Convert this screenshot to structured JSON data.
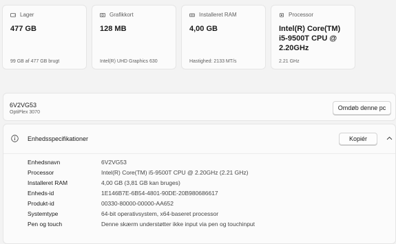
{
  "cards": [
    {
      "label": "Lager",
      "value": "477 GB",
      "sub": "99 GB af 477 GB brugt",
      "icon": "storage-icon"
    },
    {
      "label": "Grafikkort",
      "value": "128 MB",
      "sub": "Intel(R) UHD Graphics 630",
      "icon": "graphics-card-icon"
    },
    {
      "label": "Installeret RAM",
      "value": "4,00 GB",
      "sub": "Hastighed: 2133 MT/s",
      "icon": "memory-icon"
    },
    {
      "label": "Processor",
      "value_lines": [
        "Intel(R) Core(TM)",
        "i5-9500T CPU @",
        "2.20GHz"
      ],
      "sub": "2.21 GHz",
      "icon": "processor-icon"
    }
  ],
  "device": {
    "name": "6V2VG53",
    "model": "OptiPlex 3070",
    "rename_label": "Omdøb denne pc"
  },
  "specs": {
    "title": "Enhedsspecifikationer",
    "copy_label": "Kopiér",
    "rows": [
      {
        "key": "Enhedsnavn",
        "value": "6V2VG53"
      },
      {
        "key": "Processor",
        "value": "Intel(R) Core(TM) i5-9500T CPU @ 2.20GHz (2.21 GHz)"
      },
      {
        "key": "Installeret RAM",
        "value": "4,00 GB (3,81 GB kan bruges)"
      },
      {
        "key": "Enheds-id",
        "value": "1E146B7E-6B54-4801-90DE-20B980686617"
      },
      {
        "key": "Produkt-id",
        "value": "00330-80000-00000-AA652"
      },
      {
        "key": "Systemtype",
        "value": "64-bit operativsystem, x64-baseret processor"
      },
      {
        "key": "Pen og touch",
        "value": "Denne skærm understøtter ikke input via pen og touchinput"
      }
    ]
  }
}
